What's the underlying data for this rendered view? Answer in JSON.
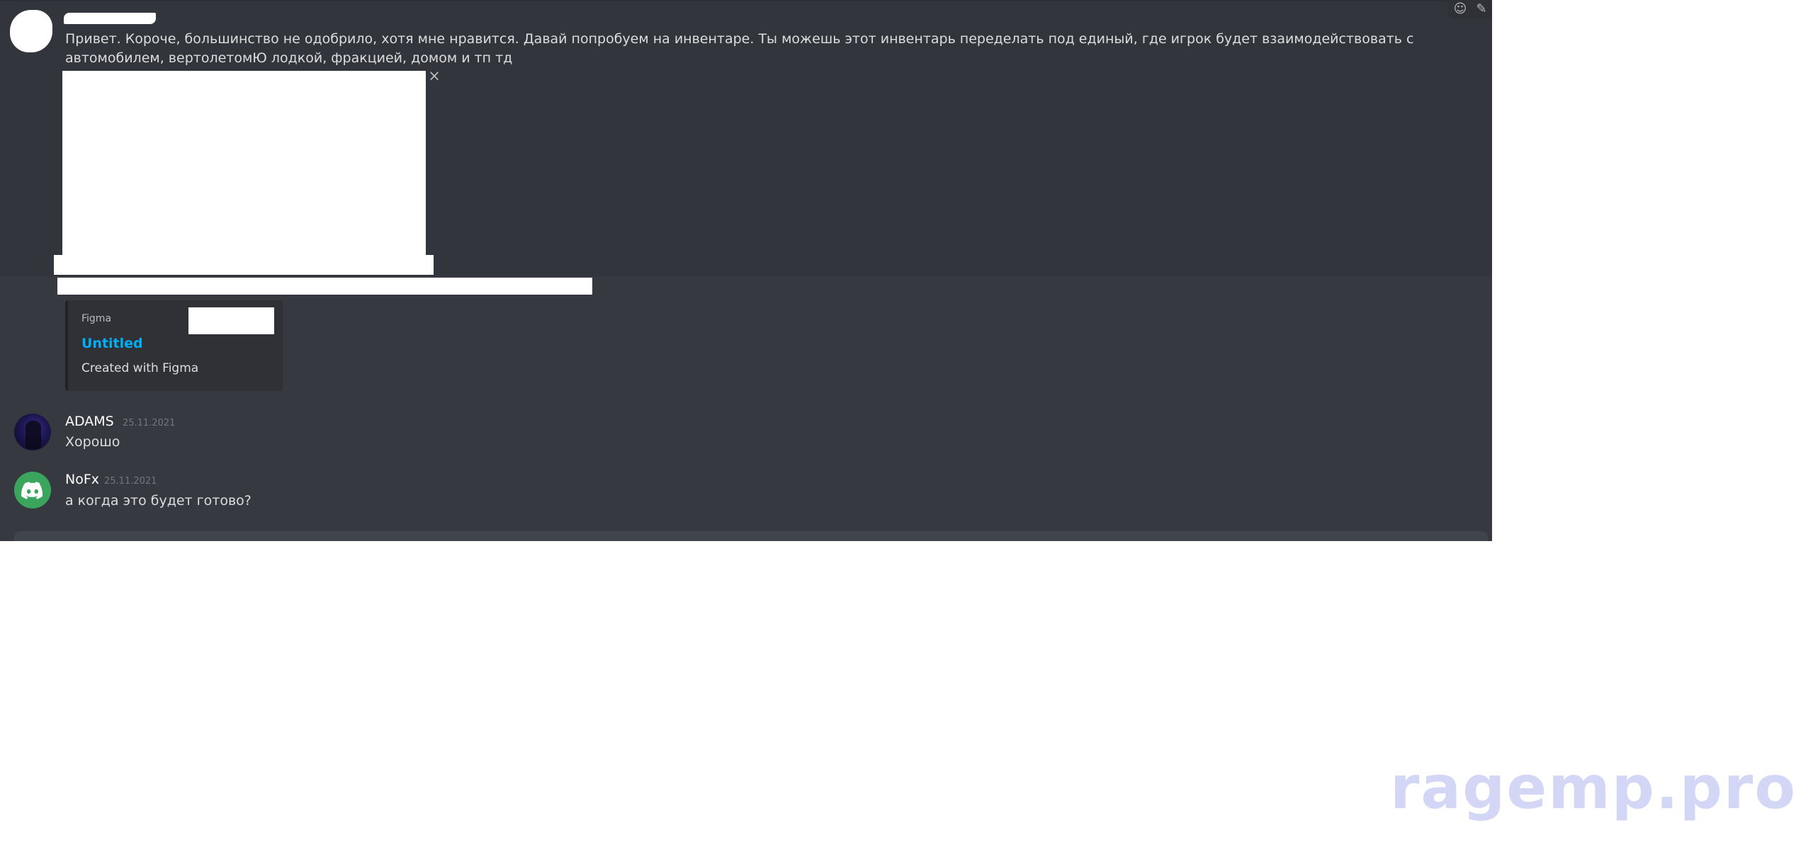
{
  "message_1": {
    "text": "Привет. Короче, большинство не одобрило, хотя мне нравится. Давай попробуем на инвентаре. Ты можешь этот инвентарь переделать под единый, где игрок будет взаимодействовать с автомобилем, вертолетомЮ лодкой, фракцией, домом и тп тд",
    "close_icon": "×",
    "embed": {
      "provider": "Figma",
      "title": "Untitled",
      "description": "Created with Figma"
    }
  },
  "message_2": {
    "username": "ADAMS",
    "timestamp": "25.11.2021",
    "body": "Хорошо"
  },
  "message_3": {
    "username": "NoFx",
    "timestamp": "25.11.2021",
    "body": "а когда это будет готово?"
  },
  "toolbar": {
    "reaction_icon": "☺",
    "edit_icon": "✎"
  },
  "watermark": "ragemp.pro",
  "colors": {
    "chat_background": "#36393f",
    "text": "#dcddde",
    "link": "#00aff4",
    "timestamp": "#72767d",
    "nofx_avatar": "#3ba55d",
    "watermark": "#d3d7f5"
  }
}
